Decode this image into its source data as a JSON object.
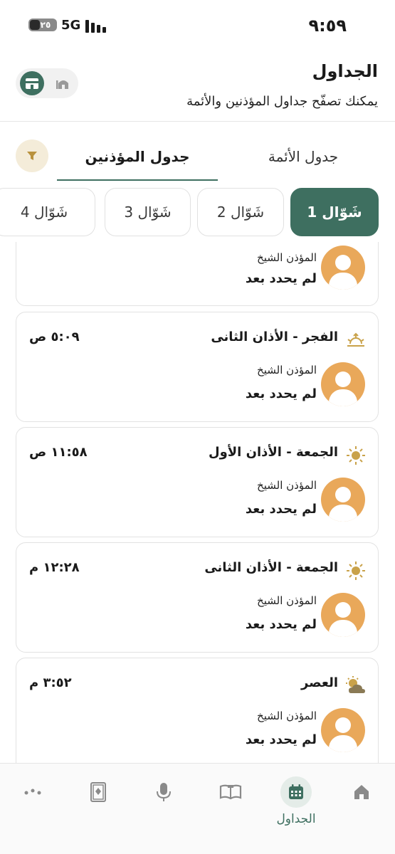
{
  "status_bar": {
    "time": "٩:٥٩",
    "battery": "٢٥",
    "network": "5G"
  },
  "header": {
    "title": "الجداول",
    "subtitle": "يمكنك تصفّح جداول المؤذنين والأئمة"
  },
  "tabs": {
    "imams": "جدول الأئمة",
    "muezzins": "جدول المؤذنين",
    "selected": "muezzins"
  },
  "dates": [
    {
      "label": "1 شَوّال",
      "active": true
    },
    {
      "label": "2 شَوّال",
      "active": false
    },
    {
      "label": "3 شَوّال",
      "active": false
    },
    {
      "label": "4 شَوّال",
      "active": false
    }
  ],
  "cards": [
    {
      "name": "",
      "time": "",
      "icon": "",
      "muezzin_label": "المؤذن الشيخ",
      "muezzin_value": "لم يحدد بعد"
    },
    {
      "name": "الفجر - الأذان الثانى",
      "time": "٥:٠٩ ص",
      "icon": "sunrise-icon",
      "muezzin_label": "المؤذن الشيخ",
      "muezzin_value": "لم يحدد بعد"
    },
    {
      "name": "الجمعة - الأذان الأول",
      "time": "١١:٥٨ ص",
      "icon": "sun-icon",
      "muezzin_label": "المؤذن الشيخ",
      "muezzin_value": "لم يحدد بعد"
    },
    {
      "name": "الجمعة - الأذان الثانى",
      "time": "١٢:٢٨ م",
      "icon": "sun-icon",
      "muezzin_label": "المؤذن الشيخ",
      "muezzin_value": "لم يحدد بعد"
    },
    {
      "name": "العصر",
      "time": "٣:٥٢ م",
      "icon": "sun-cloud-icon",
      "muezzin_label": "المؤذن الشيخ",
      "muezzin_value": "لم يحدد بعد"
    }
  ],
  "bottom_nav": {
    "items": [
      {
        "icon": "home-icon"
      },
      {
        "icon": "open-book-icon"
      },
      {
        "icon": "calendar-icon",
        "label": "الجداول",
        "active": true
      },
      {
        "icon": "microphone-icon"
      },
      {
        "icon": "quran-icon"
      },
      {
        "icon": "more-dots-icon"
      }
    ]
  },
  "colors": {
    "primary": "#3e6f60",
    "accent": "#e9a85a",
    "gold": "#c9a24a",
    "filter_bg": "#f4ecd9"
  }
}
